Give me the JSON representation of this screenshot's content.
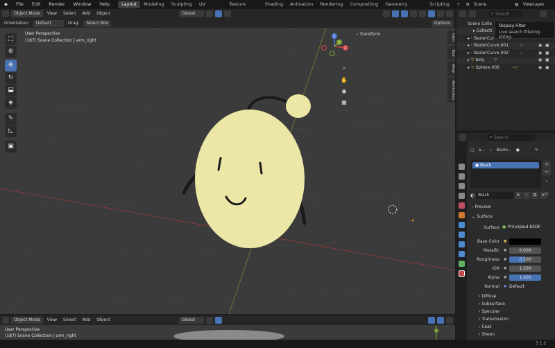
{
  "topbar": {
    "menus": [
      "File",
      "Edit",
      "Render",
      "Window",
      "Help"
    ],
    "workspaces": [
      "Layout",
      "Modeling",
      "Sculpting",
      "UV Editing",
      "Texture Paint",
      "Shading",
      "Animation",
      "Rendering",
      "Compositing",
      "Geometry Nodes",
      "Scripting"
    ],
    "add": "+",
    "scene": "Scene",
    "view_layer": "ViewLayer"
  },
  "viewport_header": {
    "mode": "Object Mode",
    "menus": [
      "View",
      "Select",
      "Add",
      "Object"
    ],
    "transform": "Global",
    "orientation_label": "Orientation:",
    "orientation_value": "Default",
    "drag_label": "Drag:",
    "drag_value": "Select Box",
    "options": "Options"
  },
  "viewport": {
    "perspective": "User Perspective",
    "collection_info": "(187) Scene Collection | arm_right",
    "transform_panel": "Transform",
    "side_tabs": [
      "Item",
      "Tool",
      "View",
      "Animation"
    ],
    "gizmo": {
      "x": "X",
      "y": "Y",
      "z": "Z"
    },
    "tools": [
      "select-tool",
      "cursor-tool",
      "move-tool",
      "rotate-tool",
      "scale-tool",
      "transform-tool",
      "annotate-tool",
      "measure-tool",
      "add-cube-tool"
    ]
  },
  "outliner": {
    "search_placeholder": "Search",
    "tooltip_title": "Display Filter",
    "tooltip_body": "Live search filtering string.",
    "root": "Scene Colle",
    "items": [
      "Collecti",
      "BezierCur",
      "BezierCurve.001",
      "BezierCurve.002",
      "boly",
      "Sphere.002"
    ]
  },
  "properties": {
    "search_placeholder": "Search",
    "breadcrumb_a": "a...",
    "breadcrumb_b": "Bezie...",
    "material_slot": "Black",
    "material_name": "Black",
    "material_users": "6",
    "sections": {
      "preview": "Preview",
      "surface": "Surface"
    },
    "surface_label": "Surface",
    "surface_value": "Principled BSDF",
    "fields": [
      {
        "label": "Base Color",
        "value": ""
      },
      {
        "label": "Metallic",
        "value": "0.000"
      },
      {
        "label": "Roughness",
        "value": "0.500"
      },
      {
        "label": "IOR",
        "value": "1.500"
      },
      {
        "label": "Alpha",
        "value": "1.000"
      },
      {
        "label": "Normal",
        "value": "Default"
      }
    ],
    "subsections": [
      "Diffuse",
      "Subsurface",
      "Specular",
      "Transmission",
      "Coat",
      "Sheen"
    ]
  },
  "bottom_editor": {
    "mode": "Object Mode",
    "menus": [
      "View",
      "Select",
      "Add",
      "Object"
    ],
    "transform": "Global",
    "perspective": "User Perspective",
    "collection_info": "(187) Scene Collection | arm_right"
  },
  "status": {
    "version": "5.1.2"
  },
  "colors": {
    "accent": "#4772b3",
    "body": "#efeaa4",
    "viewport": "#3b3b3b"
  }
}
